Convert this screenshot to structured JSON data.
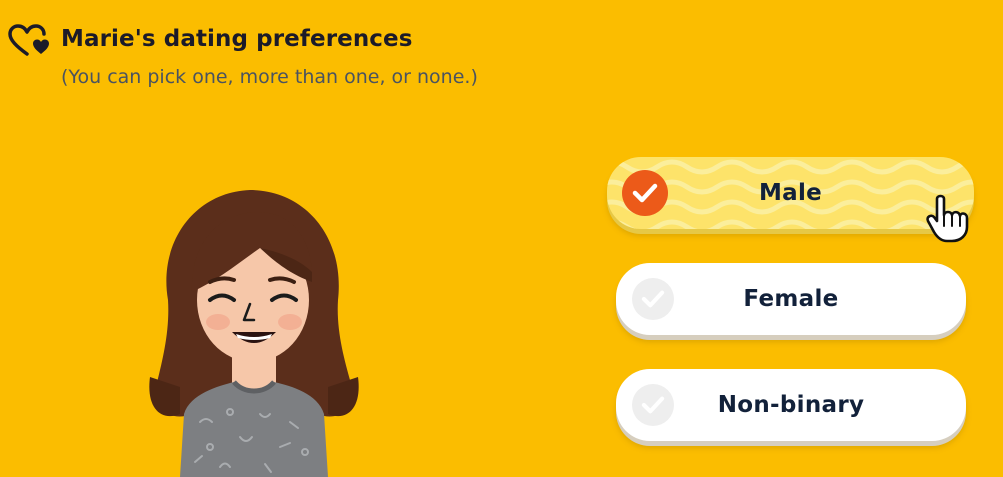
{
  "header": {
    "icon": "heart-outline-with-heart-icon",
    "title": "Marie's dating preferences",
    "subtitle": "(You can pick one, more than one, or none.)"
  },
  "avatar": {
    "icon": "bitmoji-avatar"
  },
  "options": [
    {
      "label": "Male",
      "selected": true,
      "icon": "check-icon"
    },
    {
      "label": "Female",
      "selected": false,
      "icon": "check-icon"
    },
    {
      "label": "Non-binary",
      "selected": false,
      "icon": "check-icon"
    }
  ],
  "cursor": {
    "icon": "hand-pointer-icon"
  },
  "colors": {
    "background": "#fbbd00",
    "selected_fill": "#fde36a",
    "check_selected": "#ec5a19",
    "check_unselected": "#eeeeee",
    "text": "#12213a"
  }
}
